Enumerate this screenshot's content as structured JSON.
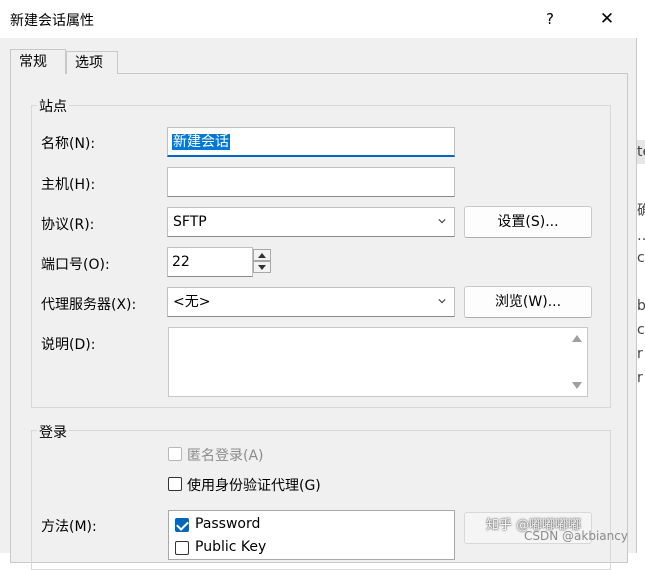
{
  "window": {
    "title": "新建会话属性",
    "help_label": "?",
    "close_label": "✕"
  },
  "tabs": [
    {
      "label": "常规",
      "active": true
    },
    {
      "label": "选项",
      "active": false
    }
  ],
  "site_group": {
    "title": "站点",
    "name_label": "名称(N):",
    "name_value": "新建会话",
    "host_label": "主机(H):",
    "host_value": "",
    "protocol_label": "协议(R):",
    "protocol_value": "SFTP",
    "settings_button": "设置(S)...",
    "port_label": "端口号(O):",
    "port_value": "22",
    "proxy_label": "代理服务器(X):",
    "proxy_value": "<无>",
    "browse_button": "浏览(W)...",
    "description_label": "说明(D):",
    "description_value": ""
  },
  "login_group": {
    "title": "登录",
    "anonymous_label": "匿名登录(A)",
    "anonymous_checked": false,
    "anonymous_enabled": false,
    "agent_label": "使用身份验证代理(G)",
    "agent_checked": false,
    "method_label": "方法(M):",
    "methods": [
      {
        "label": "Password",
        "checked": true
      },
      {
        "label": "Public Key",
        "checked": false
      }
    ]
  },
  "watermark": {
    "line1": "知乎 @嘟嘟嘟嘟",
    "line2": "CSDN @akbiancy"
  },
  "background_glyphs": [
    "te",
    "确",
    "…",
    "c",
    "b",
    "c",
    "r",
    "r"
  ],
  "colors": {
    "accent": "#0067c0",
    "selection": "#0078d7",
    "dialog_bg": "#f0f0f0"
  }
}
